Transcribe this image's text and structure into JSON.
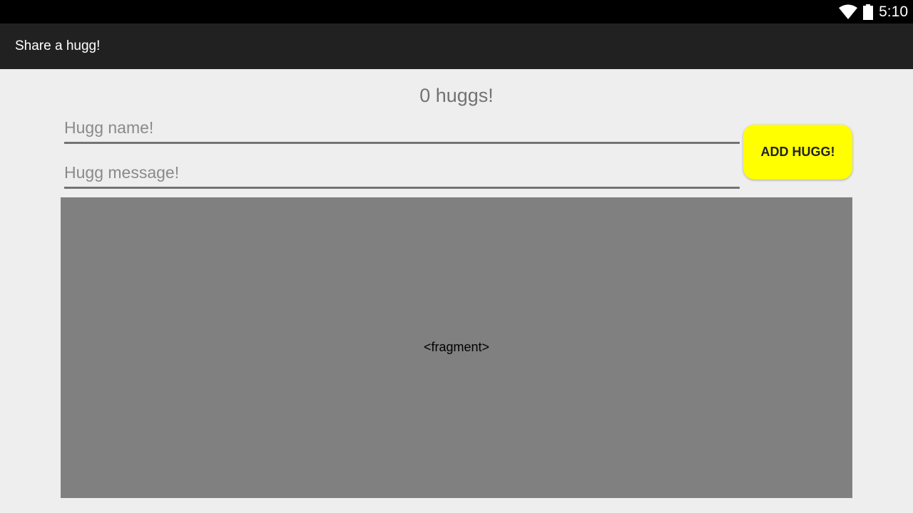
{
  "status_bar": {
    "time": "5:10",
    "wifi_icon": "wifi-icon",
    "battery_icon": "battery-icon"
  },
  "action_bar": {
    "title": "Share a hugg!"
  },
  "main": {
    "hugg_count": "0 huggs!",
    "name_field": {
      "value": "",
      "placeholder": "Hugg name!"
    },
    "message_field": {
      "value": "",
      "placeholder": "Hugg message!"
    },
    "add_button_label": "ADD HUGG!",
    "fragment_label": "<fragment>"
  },
  "colors": {
    "status_bar": "#000000",
    "action_bar": "#212121",
    "background": "#eeeeee",
    "add_button": "#ffff00",
    "fragment": "#808080"
  }
}
